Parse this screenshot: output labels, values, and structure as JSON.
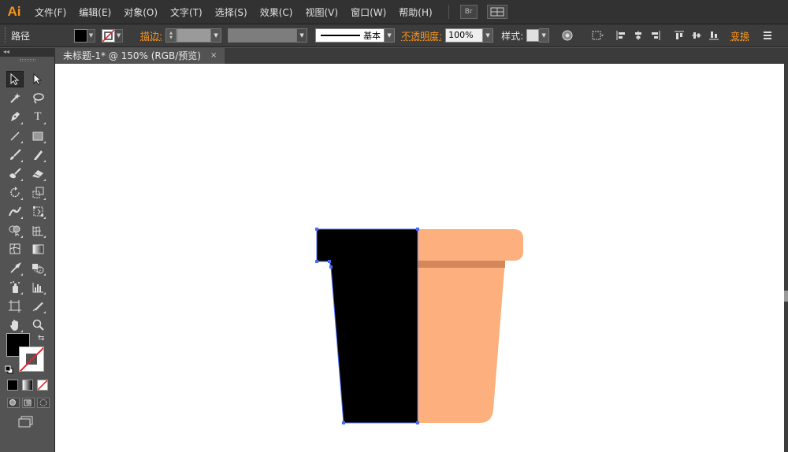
{
  "app": {
    "logo": "Ai"
  },
  "menu": [
    "文件(F)",
    "编辑(E)",
    "对象(O)",
    "文字(T)",
    "选择(S)",
    "效果(C)",
    "视图(V)",
    "窗口(W)",
    "帮助(H)"
  ],
  "menu_buttons": {
    "bridge": "Br"
  },
  "control_bar": {
    "selection_type": "路径",
    "stroke_label": "描边:",
    "stroke_profile": "基本",
    "opacity_label": "不透明度:",
    "opacity_value": "100%",
    "style_label": "样式:",
    "transform_label": "变换"
  },
  "document_tab": {
    "title": "未标题-1* @ 150% (RGB/预览)",
    "close": "×"
  },
  "tool_panel": {
    "collapse": "◂◂"
  },
  "colors": {
    "fill": "#000000",
    "pot_orange": "#fdb07d",
    "pot_band": "#d4875a",
    "selection_blue": "#4a6cf0",
    "canvas": "#ffffff"
  },
  "icons": {
    "selection": "selection-tool-icon",
    "direct": "direct-selection-tool-icon",
    "magic": "magic-wand-icon",
    "lasso": "lasso-icon",
    "pen": "pen-tool-icon",
    "type": "type-tool-icon",
    "line": "line-segment-icon",
    "rect": "rectangle-tool-icon",
    "brush": "paintbrush-icon",
    "pencil": "pencil-icon",
    "blob": "blob-brush-icon",
    "eraser": "eraser-icon",
    "rotate": "rotate-tool-icon",
    "scale": "scale-tool-icon",
    "width": "width-tool-icon",
    "free": "free-transform-icon",
    "shape": "shape-builder-icon",
    "perspective": "perspective-grid-icon",
    "mesh": "mesh-tool-icon",
    "gradient": "gradient-tool-icon",
    "eyedropper": "eyedropper-icon",
    "blend": "blend-tool-icon",
    "symbol": "symbol-sprayer-icon",
    "graph": "column-graph-icon",
    "artboard": "artboard-tool-icon",
    "slice": "slice-tool-icon",
    "hand": "hand-tool-icon",
    "zoom": "zoom-tool-icon"
  }
}
